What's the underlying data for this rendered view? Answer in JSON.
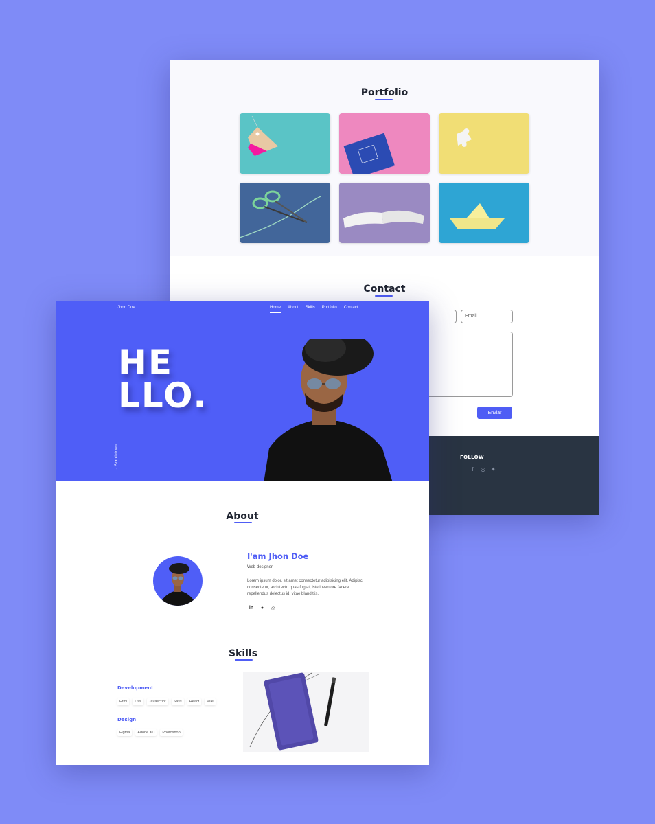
{
  "back": {
    "portfolio_title": "Portfolio",
    "contact_title": "Contact",
    "email_placeholder": "Email",
    "send_label": "Enviar",
    "follow_title": "FOLLOW",
    "social_icons": [
      "facebook-icon",
      "instagram-icon",
      "twitter-icon"
    ]
  },
  "front": {
    "brand": "Jhon Doe",
    "nav": [
      "Home",
      "About",
      "Skills",
      "Portfolio",
      "Contact"
    ],
    "hero_line1": "HE",
    "hero_line2": "LLO.",
    "scroll_down": "Scroll down",
    "about_title": "About",
    "about_name": "I'am Jhon Doe",
    "about_role": "Web designer",
    "about_text": "Lorem ipsum dolor, sit amet consectetur adipisicing elit. Adipisci consectetur, architecto quas fugiat, iste inventore facere repellendus delectus id, vitae blanditiis.",
    "about_social_icons": [
      "linkedin-icon",
      "github-icon",
      "dribbble-icon"
    ],
    "skills_title": "Skills",
    "development_title": "Development",
    "development_tags": [
      "Html",
      "Css",
      "Javascript",
      "Sass",
      "React",
      "Vue"
    ],
    "design_title": "Design",
    "design_tags": [
      "Figma",
      "Adobe XD",
      "Photoshop"
    ]
  },
  "colors": {
    "background": "#7f8bf7",
    "accent": "#4f5df5",
    "hero": "#4f5ef7",
    "footer": "#293442"
  }
}
